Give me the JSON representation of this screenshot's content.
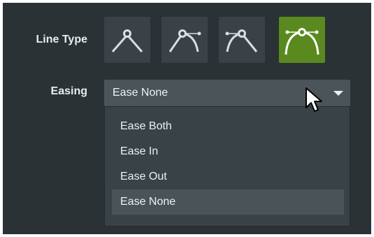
{
  "line_type": {
    "label": "Line Type",
    "buttons": [
      {
        "name": "line-type-straight",
        "active": false
      },
      {
        "name": "line-type-curve-right",
        "active": false
      },
      {
        "name": "line-type-curve-both",
        "active": false
      },
      {
        "name": "line-type-curve-smooth",
        "active": true
      }
    ],
    "active_color": "#5a8a1f"
  },
  "easing": {
    "label": "Easing",
    "selected_value": "Ease None",
    "options": [
      "Ease Both",
      "Ease In",
      "Ease Out",
      "Ease None"
    ],
    "highlighted_option": "Ease None"
  }
}
